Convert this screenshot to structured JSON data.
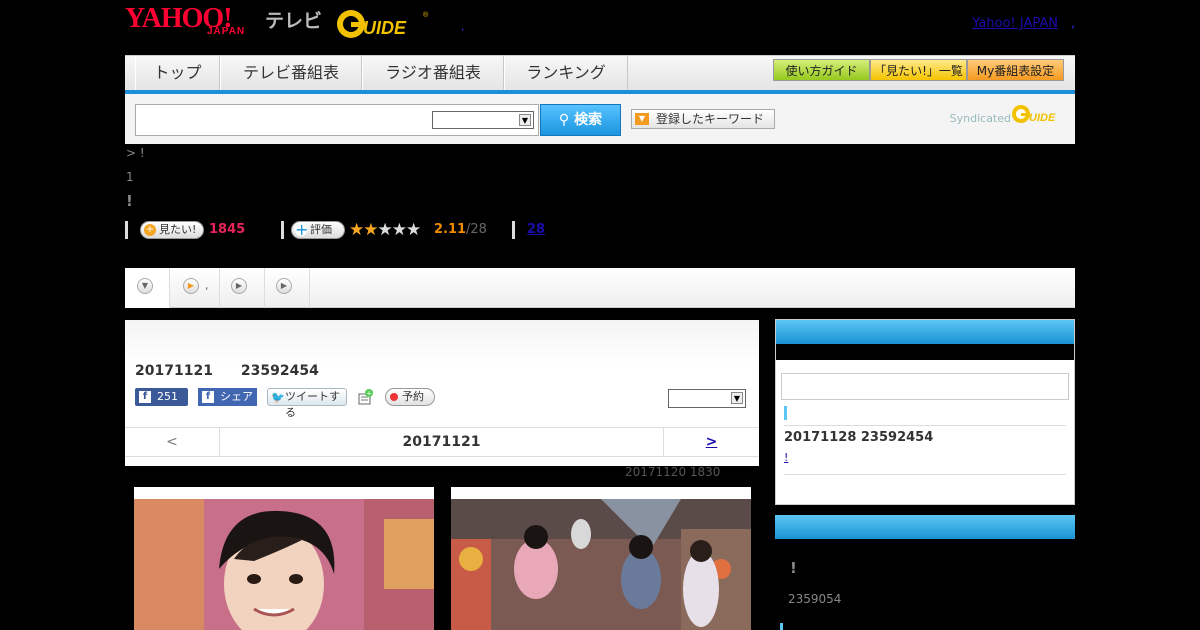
{
  "header": {
    "yahoo_logo": "YAHOO!",
    "yahoo_sub": "JAPAN",
    "tv_label": "テレビ",
    "gguide_logo": "G-GUIDE",
    "dot": ",",
    "yahoo_japan_link": "Yahoo! JAPAN",
    "comma": ","
  },
  "nav": {
    "tabs": [
      {
        "label": "トップ"
      },
      {
        "label": "テレビ番組表"
      },
      {
        "label": "ラジオ番組表"
      },
      {
        "label": "ランキング"
      }
    ],
    "guide_btn": "使い方ガイド",
    "mitai_btn": "「見たい!」一覧",
    "my_btn": "My番組表設定"
  },
  "search": {
    "input_value": "",
    "select_value": "",
    "button_label": "検索",
    "keyword_btn": "登録したキーワード",
    "syndicated": "Syndicated"
  },
  "program": {
    "breadcrumb": "> !",
    "line1": "1",
    "line2": "!",
    "want_label": "見たい!",
    "want_count": "1845",
    "rate_label": "評価",
    "stars_filled": 2,
    "stars_total": 5,
    "rating": "2.11",
    "rating_count": "/28",
    "review_count": "28"
  },
  "tabs": {
    "tab2_label": ","
  },
  "main": {
    "title": "20171121　　23592454",
    "fb_like_count": "251",
    "fb_share": "シェア",
    "tweet": "ツイートする",
    "reserve": "予約",
    "select_value": "",
    "prev": "<",
    "date": "20171121",
    "next": ">",
    "updated": "20171120  1830"
  },
  "sidebar": {
    "item_text": "20171128  23592454",
    "item_link": "!",
    "box2_exclaim": "!",
    "box2_id": "2359054"
  },
  "colors": {
    "brand_red": "#ff0033",
    "accent_blue": "#1b8fd8",
    "want_pink": "#e8245b",
    "rating_orange": "#f08a00"
  }
}
